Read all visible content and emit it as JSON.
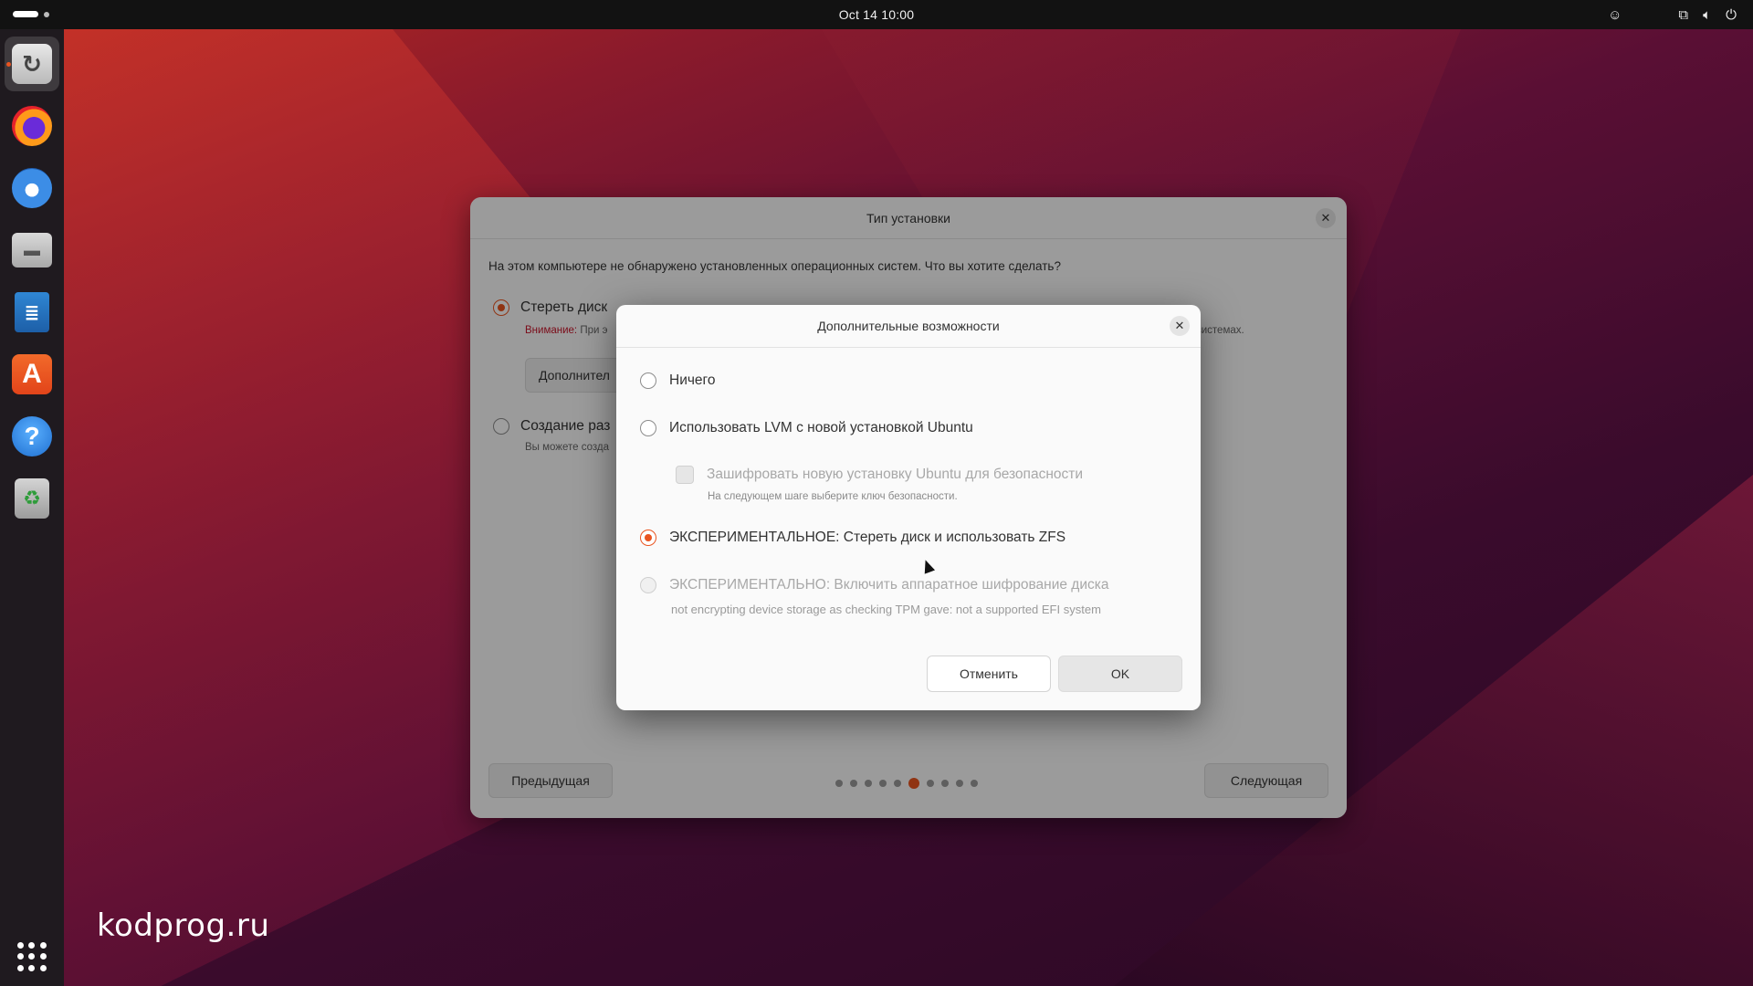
{
  "topbar": {
    "clock": "Oct 14  10:00",
    "icons": [
      "accessibility-icon",
      "network-icon",
      "volume-icon",
      "power-icon"
    ]
  },
  "dock": {
    "items": [
      "installer",
      "firefox",
      "thunderbird",
      "files",
      "libreoffice-writer",
      "app-center",
      "help",
      "trash"
    ],
    "show_apps": "show-apps-grid-icon"
  },
  "watermark": "kodprog.ru",
  "main_window": {
    "title": "Тип установки",
    "question": "На этом компьютере не обнаружено установленных операционных систем. Что вы хотите сделать?",
    "option1_label": "Стереть диск",
    "option1_warn": "Внимание:",
    "option1_sub": " При э",
    "option1_sub_end": "системах.",
    "advanced_button": "Дополнител",
    "option2_label": "Создание раз",
    "option2_sub": "Вы можете созда",
    "prev_button": "Предыдущая",
    "next_button": "Следующая",
    "progress": {
      "steps": 10,
      "current": 5
    }
  },
  "dialog": {
    "title": "Дополнительные возможности",
    "options": {
      "none": "Ничего",
      "lvm": "Использовать LVM с новой установкой Ubuntu",
      "encrypt": "Зашифровать новую установку Ubuntu для безопасности",
      "encrypt_note": "На следующем шаге выберите ключ безопасности.",
      "zfs": "ЭКСПЕРИМЕНТАЛЬНОЕ: Стереть диск и использовать ZFS",
      "hw_encrypt": "ЭКСПЕРИМЕНТАЛЬНО: Включить аппаратное шифрование диска",
      "hw_encrypt_note": "not encrypting device storage as checking TPM gave: not a supported EFI system"
    },
    "cancel_button": "Отменить",
    "ok_button": "OK",
    "accent_color": "#e95420"
  }
}
